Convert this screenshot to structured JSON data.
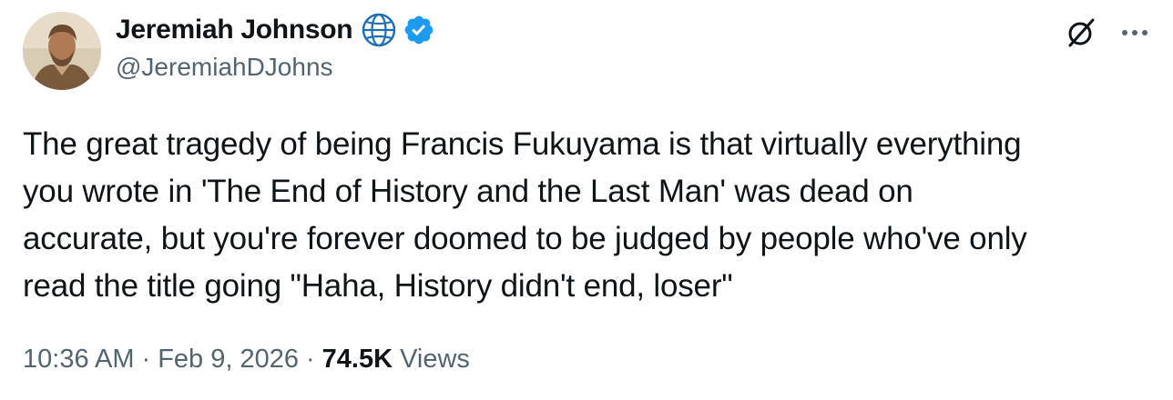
{
  "author": {
    "display_name": "Jeremiah Johnson",
    "handle": "@JeremiahDJohns",
    "badges": [
      "globe-icon",
      "verified-badge-icon"
    ],
    "verified_color": "#1d9bf0"
  },
  "actions": {
    "grok_icon": "grok-icon",
    "more_icon": "more-dots-icon"
  },
  "tweet": {
    "text": "The great tragedy of being Francis Fukuyama is that virtually everything\nyou wrote in 'The End of History and the Last Man' was dead on\naccurate, but you're forever doomed to be judged by people who've only\nread the title going \"Haha, History didn't end, loser\""
  },
  "meta": {
    "time": "10:36 AM",
    "separator": "·",
    "date": "Feb 9, 2026",
    "views_count": "74.5K",
    "views_label": "Views"
  }
}
